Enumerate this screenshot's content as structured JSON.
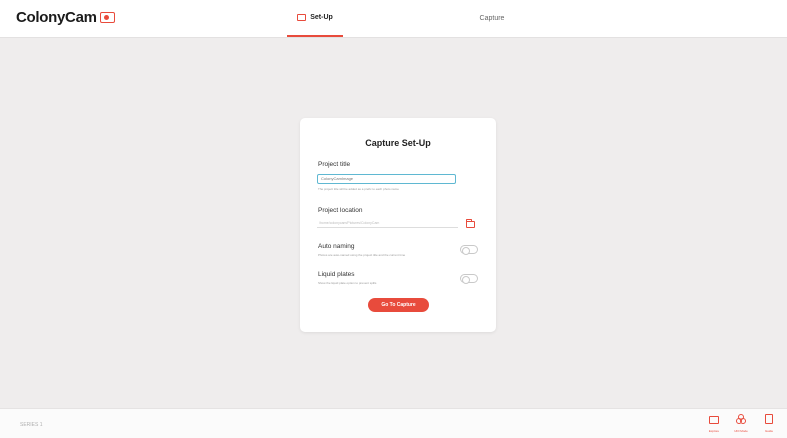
{
  "app": {
    "name": "ColonyCam"
  },
  "tabs": [
    {
      "label": "Set-Up",
      "active": true
    },
    {
      "label": "Capture",
      "active": false
    }
  ],
  "card": {
    "title": "Capture Set-Up",
    "project_title": {
      "label": "Project title",
      "value": "ColonyCamImage",
      "hint": "The project title will be added as a prefix to each photo name"
    },
    "project_location": {
      "label": "Project location",
      "value": "/home/colonycam/Pictures/ColonyCam"
    },
    "auto_naming": {
      "label": "Auto naming",
      "hint": "Photos are auto-named using the project title and the current time",
      "enabled": false
    },
    "liquid_plates": {
      "label": "Liquid plates",
      "hint": "Show the liquid plate option to prevent spills",
      "enabled": false
    },
    "go_button": "Go To Capture"
  },
  "footer": {
    "version": "SERIES 1",
    "actions": [
      {
        "label": "Explore",
        "icon": "folder-icon"
      },
      {
        "label": "UDI Mode",
        "icon": "rings-icon"
      },
      {
        "label": "Guide",
        "icon": "document-icon"
      }
    ]
  },
  "colors": {
    "accent": "#e84b3c",
    "input_focus": "#5fb8d2",
    "background": "#efeded"
  }
}
